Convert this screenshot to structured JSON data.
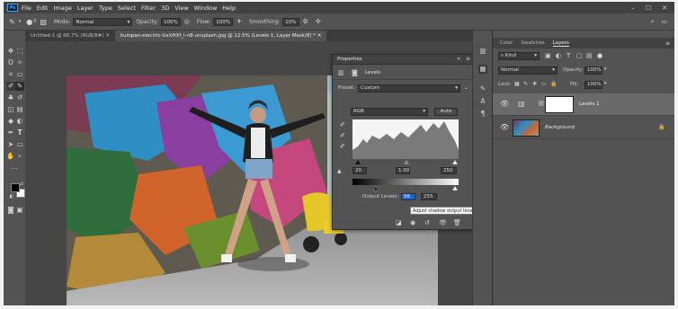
{
  "menu": [
    "File",
    "Edit",
    "Image",
    "Layer",
    "Type",
    "Select",
    "Filter",
    "3D",
    "View",
    "Window",
    "Help"
  ],
  "options": {
    "mode_label": "Mode:",
    "mode_value": "Normal",
    "opacity_label": "Opacity:",
    "opacity_value": "100%",
    "flow_label": "Flow:",
    "flow_value": "100%",
    "smoothing_label": "Smoothing:",
    "smoothing_value": "10%",
    "brush_size": "0"
  },
  "tabs": [
    {
      "label": "Untitled-1 @ 66.7% (RGB/8#)"
    },
    {
      "label": "kumpan-electric-UxXHXf_l-n8-unsplash.jpg @ 12.5% (Levels 1, Layer Mask/8) *"
    }
  ],
  "properties": {
    "title": "Properties",
    "panel_name": "Levels",
    "preset_label": "Preset:",
    "preset_value": "Custom",
    "channel_value": "RGB",
    "auto_label": "Auto",
    "input_black": "20",
    "input_mid": "1.00",
    "input_white": "250",
    "output_label": "Output Levels:",
    "output_black": "56",
    "output_white": "255",
    "tooltip": "Adjust shadow output level"
  },
  "layers_panel": {
    "tabs": [
      "Color",
      "Swatches",
      "Layers"
    ],
    "kind_label": "Kind",
    "blend_mode": "Normal",
    "opacity_label": "Opacity:",
    "opacity_value": "100%",
    "lock_label": "Lock:",
    "fill_label": "Fill:",
    "fill_value": "100%",
    "layers": [
      {
        "name": "Levels 1"
      },
      {
        "name": "Background"
      }
    ]
  },
  "colors": {
    "accent": "#31a8ff",
    "foreground": "#000000",
    "background": "#ffffff"
  }
}
